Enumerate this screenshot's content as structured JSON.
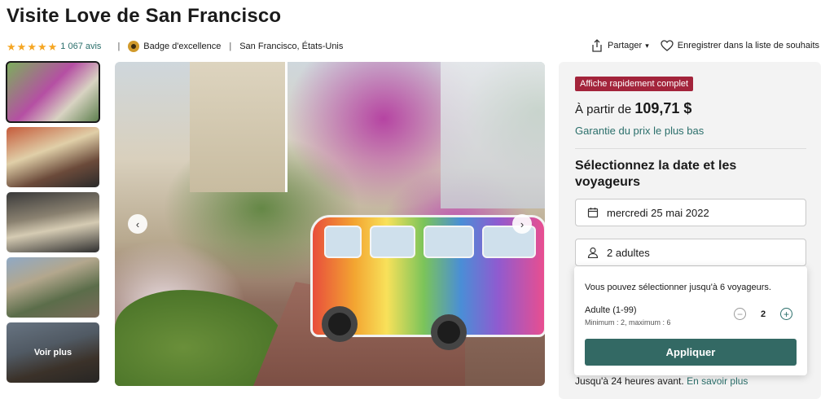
{
  "page": {
    "title": "Visite Love de San Francisco"
  },
  "meta": {
    "rating_stars": 5,
    "reviews": "1 067 avis",
    "separator": "|",
    "badge": "Badge d'excellence",
    "location": "San Francisco, États-Unis"
  },
  "actions": {
    "share": "Partager",
    "wishlist": "Enregistrer dans la liste de souhaits"
  },
  "gallery": {
    "see_more": "Voir plus"
  },
  "booking": {
    "flag": "Affiche rapidement complet",
    "price_prefix": "À partir de",
    "price": "109,71 $",
    "guarantee": "Garantie du prix le plus bas",
    "select_title": "Sélectionnez la date et les voyageurs",
    "date": "mercredi 25 mai 2022",
    "travellers": "2 adultes",
    "cancel_prefix": "Jusqu'à 24 heures avant.",
    "learn_more": "En savoir plus"
  },
  "travellers_popup": {
    "hint": "Vous pouvez sélectionner jusqu'à 6 voyageurs.",
    "category": "Adulte (1-99)",
    "limits": "Minimum : 2, maximum : 6",
    "count": "2",
    "minus": "−",
    "plus": "+",
    "apply": "Appliquer"
  },
  "colors": {
    "brand": "#336964",
    "link": "#2b6f6b",
    "flag": "#a3243b",
    "star": "#f5a623"
  }
}
